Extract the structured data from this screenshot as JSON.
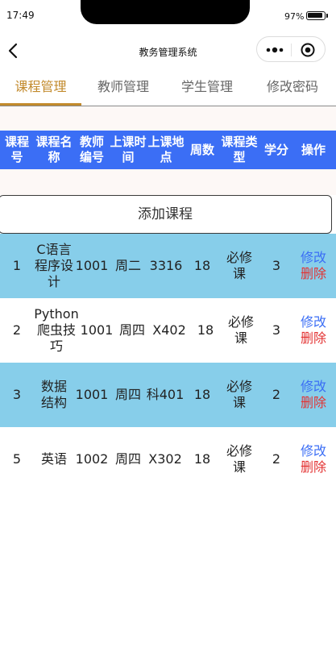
{
  "status_bar": {
    "time": "17:49",
    "battery": "97%",
    "battery_level": 0.97
  },
  "nav": {
    "title": "教务管理系统"
  },
  "tabs": [
    {
      "label": "课程管理",
      "active": true
    },
    {
      "label": "教师管理",
      "active": false
    },
    {
      "label": "学生管理",
      "active": false
    },
    {
      "label": "修改密码",
      "active": false
    }
  ],
  "table": {
    "headers": [
      "课程号",
      "课程名称",
      "教师编号",
      "上课时间",
      "上课地点",
      "周数",
      "课程类型",
      "学分",
      "操作"
    ],
    "add_button": "添加课程",
    "edit_label": "修改",
    "delete_label": "删除",
    "rows": [
      {
        "id": "1",
        "name": "C语言程序设计",
        "teacher": "1001",
        "time": "周二",
        "place": "3316",
        "weeks": "18",
        "type": "必修课",
        "credit": "3"
      },
      {
        "id": "2",
        "name": "Python爬虫技巧",
        "teacher": "1001",
        "time": "周四",
        "place": "X402",
        "weeks": "18",
        "type": "必修课",
        "credit": "3"
      },
      {
        "id": "3",
        "name": "数据结构",
        "teacher": "1001",
        "time": "周四",
        "place": "科401",
        "weeks": "18",
        "type": "必修课",
        "credit": "2"
      },
      {
        "id": "5",
        "name": "英语",
        "teacher": "1002",
        "time": "周四",
        "place": "X302",
        "weeks": "18",
        "type": "必修课",
        "credit": "2"
      }
    ]
  },
  "colors": {
    "accent": "#c28a2c",
    "header_bg": "#3b6ef5",
    "row_highlight": "#87ceea",
    "edit": "#3b6ef5",
    "delete": "#e33232"
  },
  "icons": [
    "back-icon",
    "more-icon",
    "close-miniprogram-icon"
  ]
}
